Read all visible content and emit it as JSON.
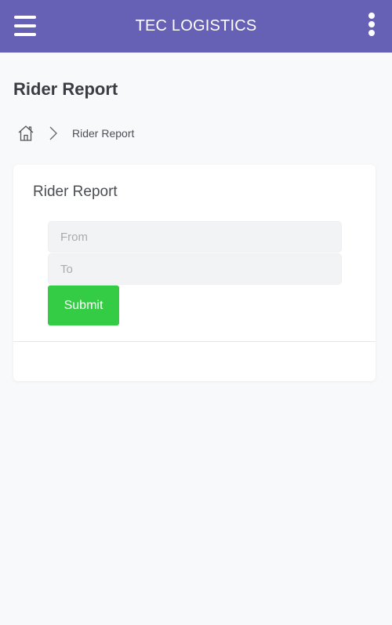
{
  "header": {
    "title": "TEC LOGISTICS",
    "menu_icon": "hamburger-menu-icon",
    "more_icon": "more-vertical-icon",
    "background": "#6761b5"
  },
  "page": {
    "title": "Rider Report"
  },
  "breadcrumb": {
    "home_icon": "home-icon",
    "separator_icon": "chevron-right-icon",
    "current": "Rider Report"
  },
  "report_form": {
    "title": "Rider Report",
    "from_placeholder": "From",
    "from_value": "",
    "to_placeholder": "To",
    "to_value": "",
    "submit_label": "Submit",
    "submit_color": "#33cc44"
  }
}
